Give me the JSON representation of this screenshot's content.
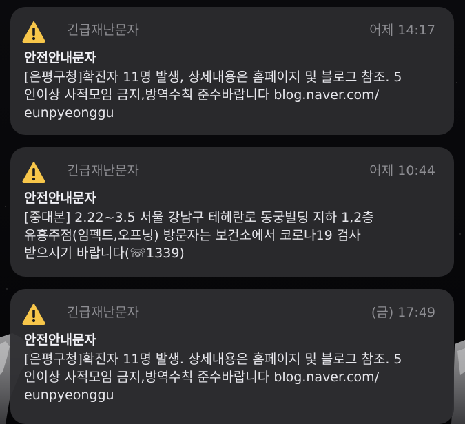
{
  "notifications": [
    {
      "icon": "warning-icon",
      "app": "긴급재난문자",
      "time": "어제 14:17",
      "title": "안전안내문자",
      "lines": [
        "[은평구청]확진자 11명 발생, 상세내용은 홈페이지 및 블로그 참조. 5",
        "인이상 사적모임 금지,방역수칙 준수바랍니다 blog.naver.com/",
        "eunpyeonggu"
      ]
    },
    {
      "icon": "warning-icon",
      "app": "긴급재난문자",
      "time": "어제 10:44",
      "title": "안전안내문자",
      "lines": [
        "[중대본] 2.22~3.5 서울 강남구 테헤란로 동궁빌딩 지하 1,2층",
        "유흥주점(임펙트,오프닝) 방문자는 보건소에서 코로나19 검사",
        "받으시기 바랍니다(☏1339)"
      ]
    },
    {
      "icon": "warning-icon",
      "app": "긴급재난문자",
      "time": "(금) 17:49",
      "title": "안전안내문자",
      "lines": [
        "[은평구청]확진자 11명 발생. 상세내용은 홈페이지 및 블로그 참조. 5",
        "인이상 사적모임 금지,방역수칙 준수바랍니다 blog.naver.com/",
        "eunpyeonggu"
      ]
    }
  ],
  "colors": {
    "warning_yellow": "#f7c64a",
    "card_background": "#2c2c2f",
    "secondary_text": "#8e8e93",
    "primary_text": "#f2f2f7"
  }
}
